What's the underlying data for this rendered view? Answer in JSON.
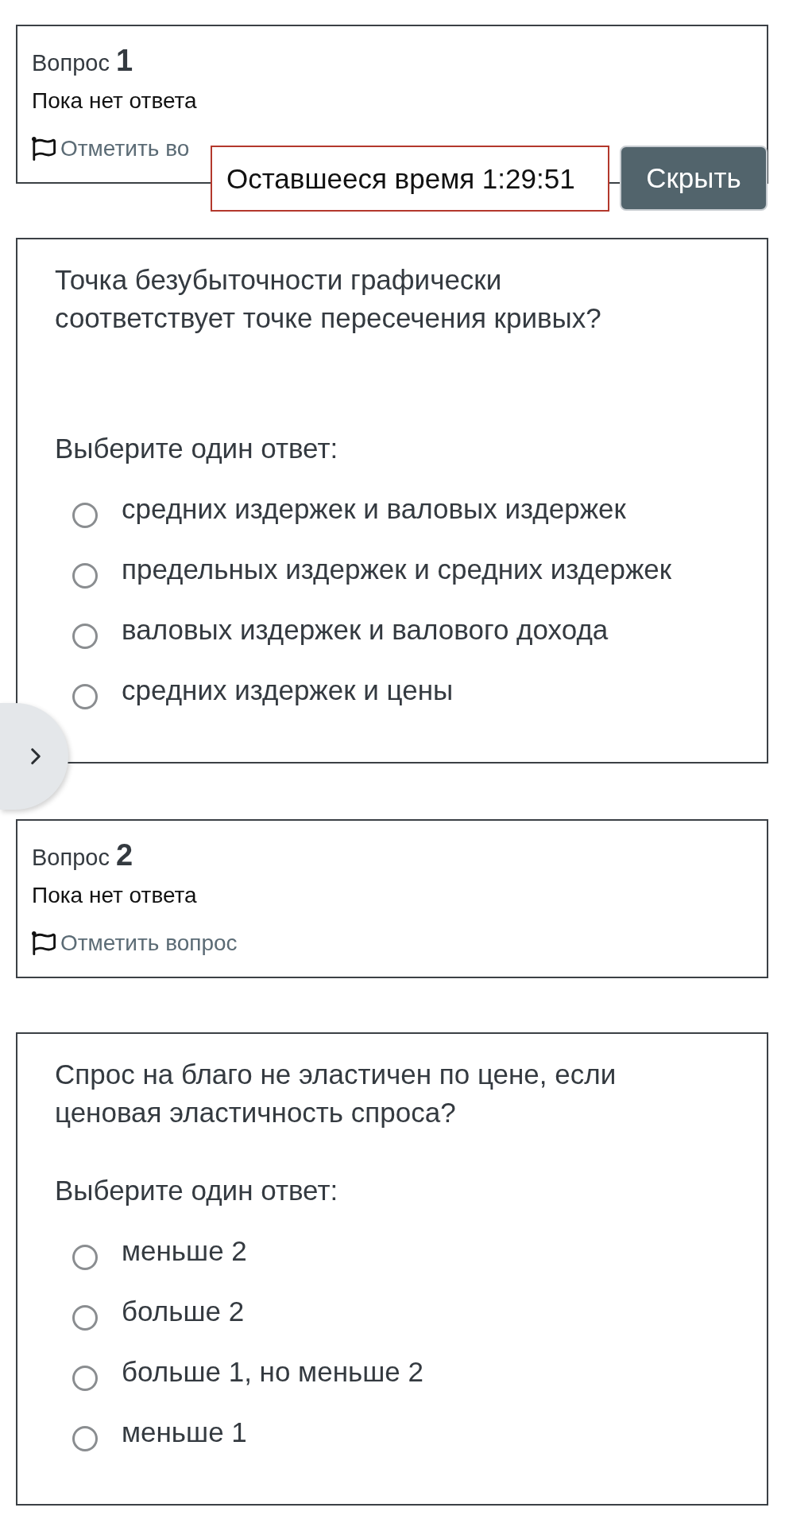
{
  "questions": [
    {
      "label": "Вопрос",
      "number": "1",
      "status": "Пока нет ответа",
      "flag": {
        "label": "Отметить во",
        "flagged": false
      },
      "text": "Точка безубыточности графически соответствует точке пересечения кривых?",
      "prompt": "Выберите один ответ:",
      "options": [
        {
          "label": "средних издержек и валовых издержек",
          "selected": false
        },
        {
          "label": "предельных издержек и средних издержек",
          "selected": false
        },
        {
          "label": "валовых издержек и валового дохода",
          "selected": false
        },
        {
          "label": "средних издержек и цены",
          "selected": false
        }
      ]
    },
    {
      "label": "Вопрос",
      "number": "2",
      "status": "Пока нет ответа",
      "flag": {
        "label": "Отметить вопрос",
        "flagged": false
      },
      "text": "Спрос на благо не эластичен по цене, если ценовая эластичность спроса?",
      "prompt": "Выберите один ответ:",
      "options": [
        {
          "label": "меньше 2",
          "selected": false
        },
        {
          "label": "больше 2",
          "selected": false
        },
        {
          "label": "больше 1, но меньше 2",
          "selected": false
        },
        {
          "label": "меньше 1",
          "selected": false
        }
      ]
    }
  ],
  "timer": {
    "text": "Оставшееся время 1:29:51",
    "hide_button": "Скрыть"
  }
}
